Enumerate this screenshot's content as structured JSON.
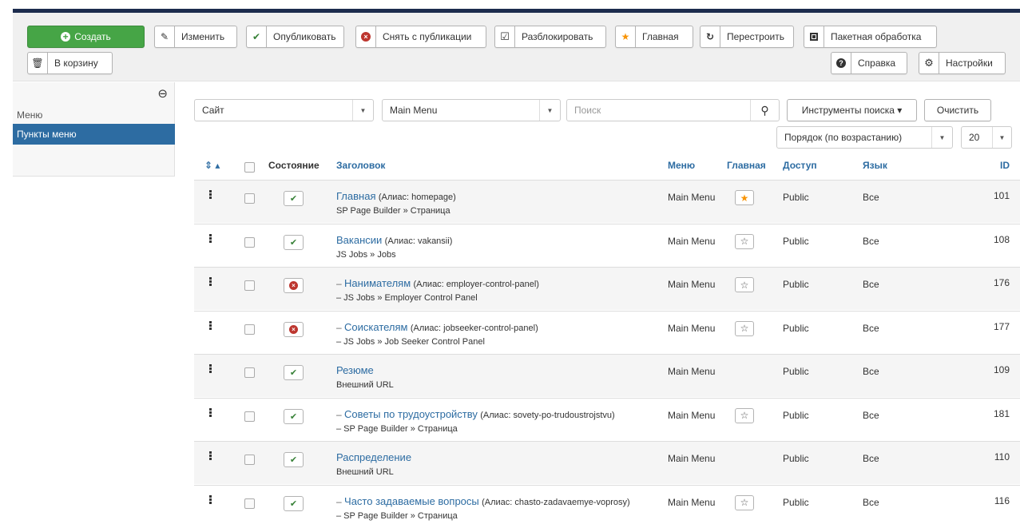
{
  "toolbar": {
    "create": "Создать",
    "edit": "Изменить",
    "publish": "Опубликовать",
    "unpublish": "Снять с публикации",
    "checkin": "Разблокировать",
    "home": "Главная",
    "rebuild": "Перестроить",
    "batch": "Пакетная обработка",
    "trash": "В корзину",
    "help": "Справка",
    "options": "Настройки"
  },
  "sidebar": {
    "items": [
      {
        "label": "Меню",
        "active": false
      },
      {
        "label": "Пункты меню",
        "active": true
      }
    ]
  },
  "filters": {
    "client": "Сайт",
    "menutype": "Main Menu",
    "search_placeholder": "Поиск",
    "search_tools": "Инструменты поиска ▾",
    "clear": "Очистить",
    "ordering": "Порядок (по возрастанию)",
    "limit": "20"
  },
  "table": {
    "headers": {
      "sort": "⇕ ▴",
      "state": "Состояние",
      "title": "Заголовок",
      "menu": "Меню",
      "home": "Главная",
      "access": "Доступ",
      "language": "Язык",
      "id": "ID"
    },
    "rows": [
      {
        "title": "Главная",
        "prefix": "",
        "alias": "(Алиас: homepage)",
        "sub": "SP Page Builder » Страница",
        "published": true,
        "menu": "Main Menu",
        "home": "default",
        "access": "Public",
        "language": "Все",
        "id": "101"
      },
      {
        "title": "Вакансии",
        "prefix": "",
        "alias": "(Алиас: vakansii)",
        "sub": "JS Jobs » Jobs",
        "published": true,
        "menu": "Main Menu",
        "home": "star",
        "access": "Public",
        "language": "Все",
        "id": "108"
      },
      {
        "title": "Нанимателям",
        "prefix": "–",
        "alias": "(Алиас: employer-control-panel)",
        "sub": "– JS Jobs » Employer Control Panel",
        "published": false,
        "menu": "Main Menu",
        "home": "star",
        "access": "Public",
        "language": "Все",
        "id": "176"
      },
      {
        "title": "Соискателям",
        "prefix": "–",
        "alias": "(Алиас: jobseeker-control-panel)",
        "sub": "– JS Jobs » Job Seeker Control Panel",
        "published": false,
        "menu": "Main Menu",
        "home": "star",
        "access": "Public",
        "language": "Все",
        "id": "177"
      },
      {
        "title": "Резюме",
        "prefix": "",
        "alias": "",
        "sub": "Внешний URL",
        "published": true,
        "menu": "Main Menu",
        "home": "none",
        "access": "Public",
        "language": "Все",
        "id": "109"
      },
      {
        "title": "Советы по трудоустройству",
        "prefix": "–",
        "alias": "(Алиас: sovety-po-trudoustrojstvu)",
        "sub": "– SP Page Builder » Страница",
        "published": true,
        "menu": "Main Menu",
        "home": "star",
        "access": "Public",
        "language": "Все",
        "id": "181"
      },
      {
        "title": "Распределение",
        "prefix": "",
        "alias": "",
        "sub": "Внешний URL",
        "published": true,
        "menu": "Main Menu",
        "home": "none",
        "access": "Public",
        "language": "Все",
        "id": "110"
      },
      {
        "title": "Часто задаваемые вопросы",
        "prefix": "–",
        "alias": "(Алиас: chasto-zadavaemye-voprosy)",
        "sub": "– SP Page Builder » Страница",
        "published": true,
        "menu": "Main Menu",
        "home": "star",
        "access": "Public",
        "language": "Все",
        "id": "116"
      }
    ]
  },
  "colors": {
    "link": "#2d6ca2",
    "success": "#46a546",
    "danger": "#bd362f",
    "star": "#f89406",
    "topbar": "#1d2c4e"
  }
}
